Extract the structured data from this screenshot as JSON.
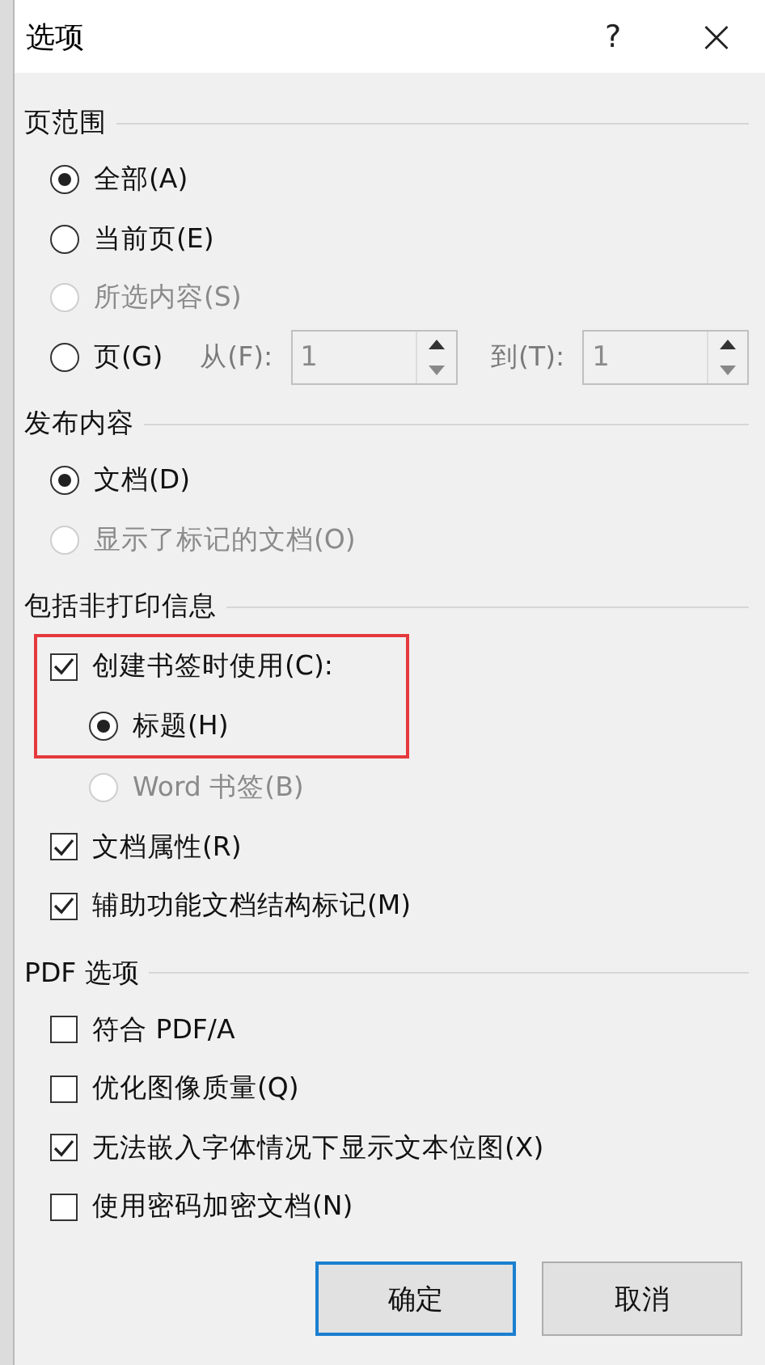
{
  "window": {
    "title": "选项",
    "help": "?",
    "close": "×"
  },
  "sections": [
    {
      "title": "页范围",
      "items": [
        {
          "kind": "radio",
          "label": "全部(A)",
          "selected": true,
          "disabled": false,
          "highlight": false
        },
        {
          "kind": "radio",
          "label": "当前页(E)",
          "selected": false,
          "disabled": false,
          "highlight": false
        },
        {
          "kind": "radio",
          "label": "所选内容(S)",
          "selected": false,
          "disabled": true,
          "highlight": false
        },
        {
          "kind": "range",
          "label": "页(G)",
          "selected": false,
          "disabled": false,
          "highlight": false,
          "fields": [
            {
              "label": "从(F):",
              "value": "1",
              "disabled": true
            },
            {
              "label": "到(T):",
              "value": "1",
              "disabled": true
            }
          ]
        }
      ]
    },
    {
      "title": "发布内容",
      "items": [
        {
          "kind": "radio",
          "label": "文档(D)",
          "selected": true,
          "disabled": false,
          "highlight": false
        },
        {
          "kind": "radio",
          "label": "显示了标记的文档(O)",
          "selected": false,
          "disabled": true,
          "highlight": false
        }
      ]
    },
    {
      "title": "包括非打印信息",
      "items": [
        {
          "kind": "checkbox",
          "label": "创建书签时使用(C):",
          "checked": true,
          "disabled": false,
          "highlight": true,
          "children": [
            {
              "kind": "radio",
              "label": "标题(H)",
              "selected": true,
              "disabled": false,
              "highlight": true
            },
            {
              "kind": "radio",
              "label": "Word 书签(B)",
              "selected": false,
              "disabled": true,
              "highlight": false
            }
          ]
        },
        {
          "kind": "checkbox",
          "label": "文档属性(R)",
          "checked": true,
          "disabled": false,
          "highlight": false
        },
        {
          "kind": "checkbox",
          "label": "辅助功能文档结构标记(M)",
          "checked": true,
          "disabled": false,
          "highlight": false
        }
      ]
    },
    {
      "title": "PDF 选项",
      "items": [
        {
          "kind": "checkbox",
          "label": "符合 PDF/A",
          "checked": false,
          "disabled": false,
          "highlight": false
        },
        {
          "kind": "checkbox",
          "label": "优化图像质量(Q)",
          "checked": false,
          "disabled": false,
          "highlight": false
        },
        {
          "kind": "checkbox",
          "label": "无法嵌入字体情况下显示文本位图(X)",
          "checked": true,
          "disabled": false,
          "highlight": false
        },
        {
          "kind": "checkbox",
          "label": "使用密码加密文档(N)",
          "checked": false,
          "disabled": false,
          "highlight": false
        }
      ]
    }
  ],
  "buttons": [
    {
      "label": "确定",
      "default": true
    },
    {
      "label": "取消",
      "default": false
    }
  ]
}
